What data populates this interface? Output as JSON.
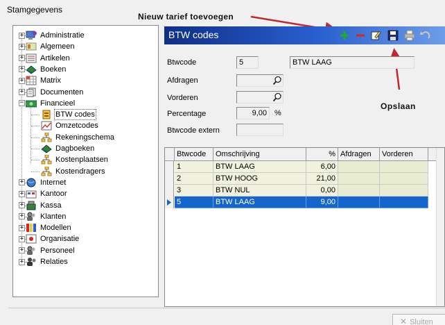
{
  "window": {
    "title": "Stamgegevens"
  },
  "annotations": {
    "new_rate": "Nieuw tarief toevoegen",
    "save": "Opslaan"
  },
  "tree": {
    "items": [
      {
        "label": "Administratie",
        "icon": "administration-icon",
        "expander": "+"
      },
      {
        "label": "Algemeen",
        "icon": "general-icon",
        "expander": "+"
      },
      {
        "label": "Artikelen",
        "icon": "articles-icon",
        "expander": "+"
      },
      {
        "label": "Boeken",
        "icon": "books-icon",
        "expander": "+"
      },
      {
        "label": "Matrix",
        "icon": "matrix-icon",
        "expander": "+"
      },
      {
        "label": "Documenten",
        "icon": "documents-icon",
        "expander": "+"
      },
      {
        "label": "Financieel",
        "icon": "financial-icon",
        "expander": "−"
      },
      {
        "label": "BTW codes",
        "icon": "vat-codes-icon",
        "child": true,
        "selected": true
      },
      {
        "label": "Omzetcodes",
        "icon": "revenue-codes-icon",
        "child": true
      },
      {
        "label": "Rekeningschema",
        "icon": "account-schema-icon",
        "child": true
      },
      {
        "label": "Dagboeken",
        "icon": "journals-icon",
        "child": true
      },
      {
        "label": "Kostenplaatsen",
        "icon": "cost-centers-icon",
        "child": true
      },
      {
        "label": "Kostendragers",
        "icon": "cost-carriers-icon",
        "child": true
      },
      {
        "label": "Internet",
        "icon": "internet-icon",
        "expander": "+"
      },
      {
        "label": "Kantoor",
        "icon": "office-icon",
        "expander": "+"
      },
      {
        "label": "Kassa",
        "icon": "cash-register-icon",
        "expander": "+"
      },
      {
        "label": "Klanten",
        "icon": "customers-icon",
        "expander": "+"
      },
      {
        "label": "Modellen",
        "icon": "models-icon",
        "expander": "+"
      },
      {
        "label": "Organisatie",
        "icon": "organisation-icon",
        "expander": "+"
      },
      {
        "label": "Personeel",
        "icon": "staff-icon",
        "expander": "+"
      },
      {
        "label": "Relaties",
        "icon": "relations-icon",
        "expander": "+"
      }
    ]
  },
  "panel": {
    "title": "BTW codes"
  },
  "toolbar": {
    "icons": [
      "add-icon",
      "delete-icon",
      "edit-icon",
      "save-icon",
      "print-icon",
      "undo-icon"
    ],
    "colors": {
      "add": "#1fae1f",
      "delete": "#d6281e",
      "header_start": "#0e2f86",
      "header_end": "#6d9de6"
    }
  },
  "form": {
    "btwcode_label": "Btwcode",
    "btwcode_value": "5",
    "btwcode_desc": "BTW LAAG",
    "afdragen_label": "Afdragen",
    "afdragen_value": "",
    "vorderen_label": "Vorderen",
    "vorderen_value": "",
    "percentage_label": "Percentage",
    "percentage_value": "9,00",
    "percentage_unit": "%",
    "extern_label": "Btwcode extern",
    "extern_value": ""
  },
  "grid": {
    "columns": [
      "Btwcode",
      "Omschrijving",
      "%",
      "Afdragen",
      "Vorderen"
    ],
    "rows": [
      {
        "code": "1",
        "desc": "BTW LAAG",
        "pct": "6,00",
        "afdragen": "",
        "vorderen": ""
      },
      {
        "code": "2",
        "desc": "BTW HOOG",
        "pct": "21,00",
        "afdragen": "",
        "vorderen": ""
      },
      {
        "code": "3",
        "desc": "BTW NUL",
        "pct": "0,00",
        "afdragen": "",
        "vorderen": ""
      },
      {
        "code": "5",
        "desc": "BTW LAAG",
        "pct": "9,00",
        "afdragen": "",
        "vorderen": "",
        "selected": true
      }
    ]
  },
  "footer": {
    "close_label": "Sluiten"
  }
}
